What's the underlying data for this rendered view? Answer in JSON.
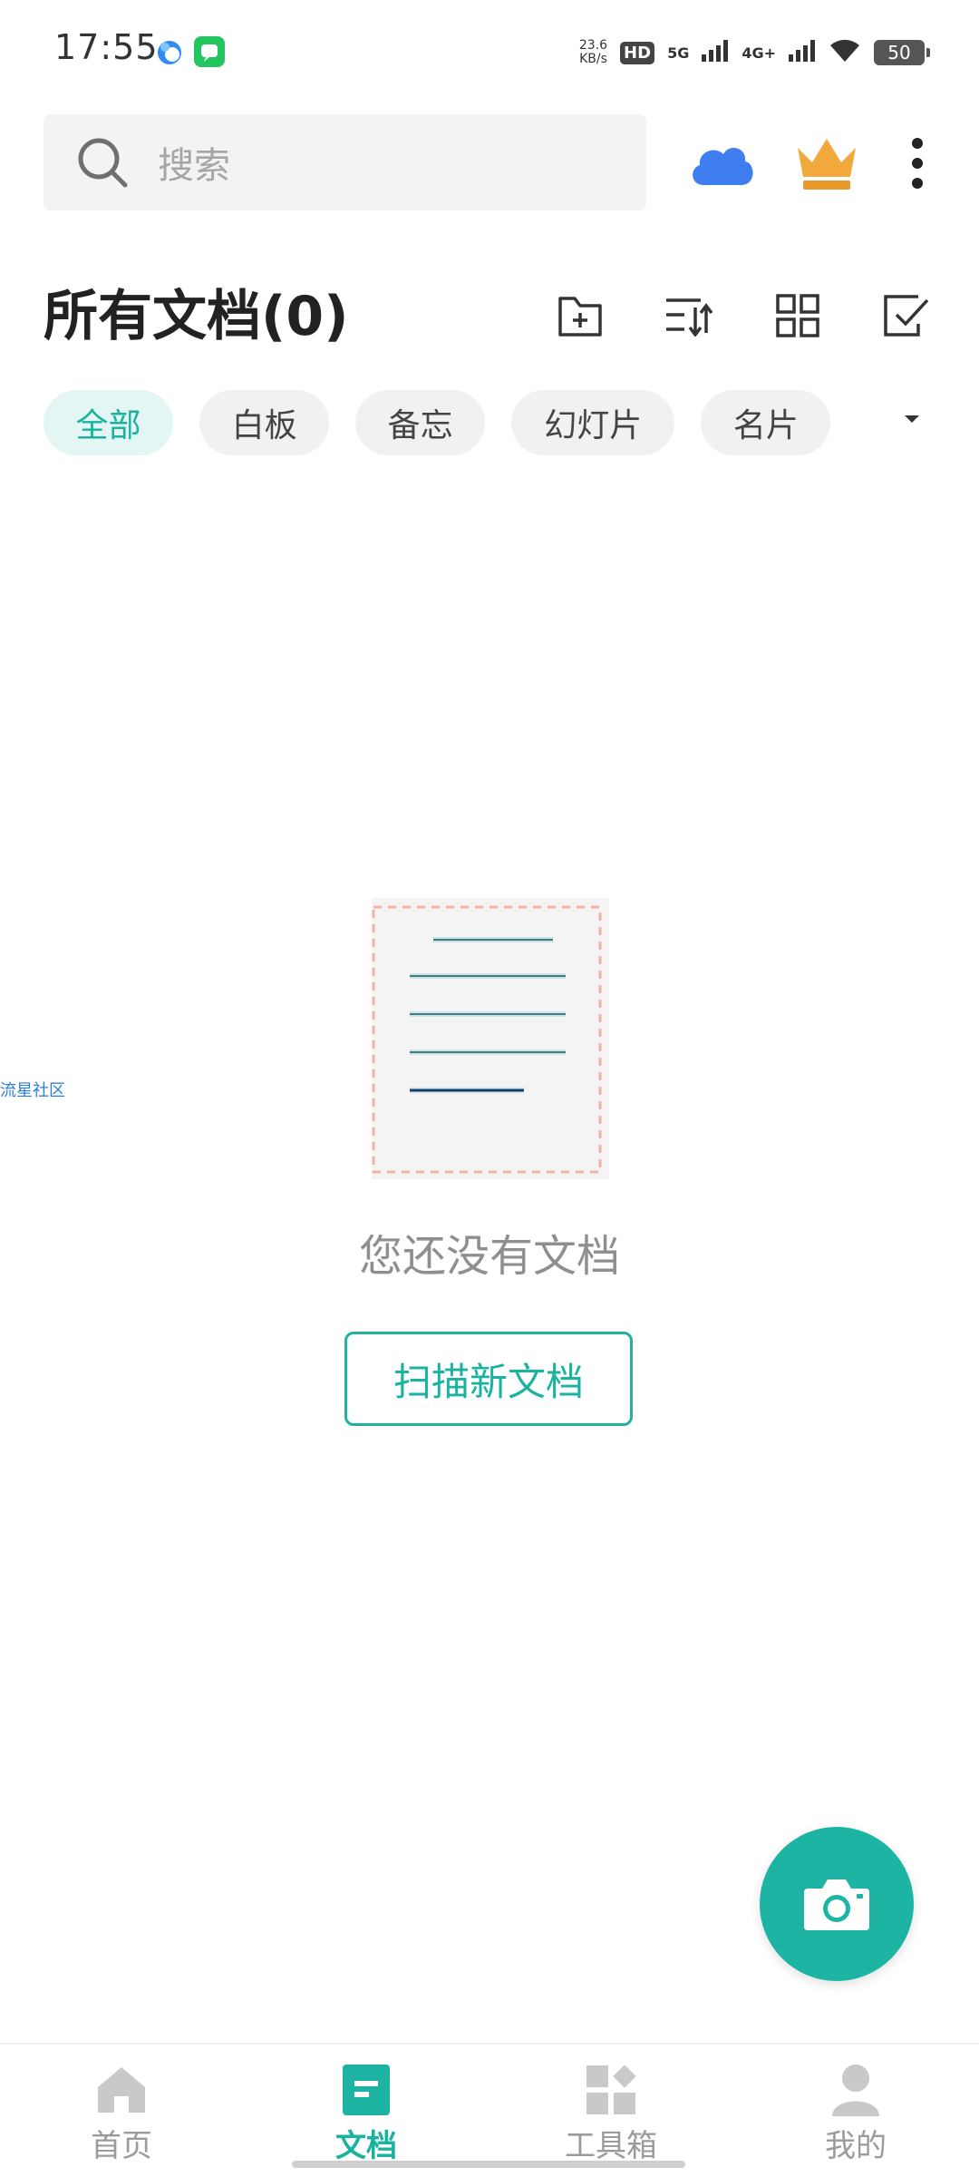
{
  "status_bar": {
    "time": "17:55",
    "net_speed_value": "23.6",
    "net_speed_unit": "KB/s",
    "hd_label": "HD",
    "sim1_label": "5G",
    "sim2_label": "4G+",
    "battery": "50"
  },
  "search": {
    "placeholder": "搜索"
  },
  "header": {
    "title": "所有文档(0)"
  },
  "filters": {
    "items": [
      "全部",
      "白板",
      "备忘",
      "幻灯片",
      "名片"
    ],
    "active": "全部"
  },
  "empty_state": {
    "message": "您还没有文档",
    "action_label": "扫描新文档"
  },
  "side_watermark": "流星社区",
  "bottom_nav": {
    "items": [
      {
        "label": "首页",
        "icon": "home-icon"
      },
      {
        "label": "文档",
        "icon": "document-icon"
      },
      {
        "label": "工具箱",
        "icon": "toolbox-icon"
      },
      {
        "label": "我的",
        "icon": "profile-icon"
      }
    ],
    "active": "文档"
  },
  "colors": {
    "accent": "#1db4a3",
    "cloud": "#3f7ef0",
    "crown": "#f0a93a"
  }
}
